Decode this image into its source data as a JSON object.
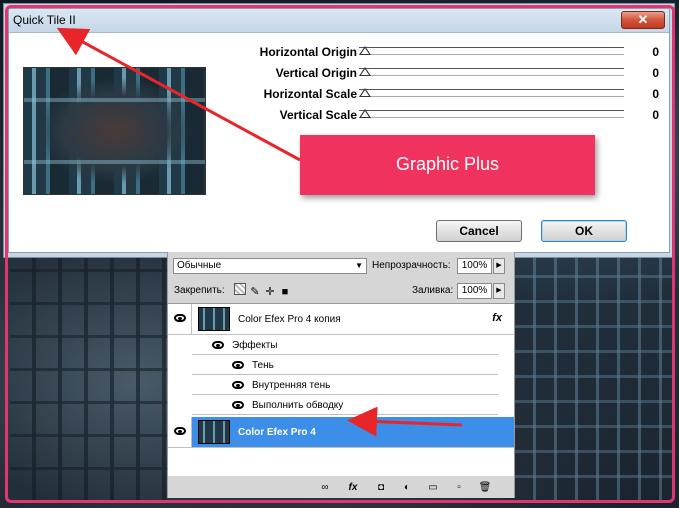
{
  "dialog": {
    "title": "Quick Tile II",
    "close_glyph": "✕",
    "params": [
      {
        "label": "Horizontal Origin",
        "value": "0"
      },
      {
        "label": "Vertical Origin",
        "value": "0"
      },
      {
        "label": "Horizontal Scale",
        "value": "0"
      },
      {
        "label": "Vertical Scale",
        "value": "0"
      }
    ],
    "cancel_label": "Cancel",
    "ok_label": "OK"
  },
  "callout": {
    "text": "Graphic Plus",
    "color": "#f0325f"
  },
  "layers_panel": {
    "blend_mode": "Обычные",
    "opacity_label": "Непрозрачность:",
    "opacity_value": "100%",
    "lock_label": "Закрепить:",
    "fill_label": "Заливка:",
    "fill_value": "100%",
    "layers": [
      {
        "name": "Color Efex Pro 4 копия",
        "fx": "fx",
        "selected": false
      },
      {
        "name": "Color Efex Pro 4",
        "selected": true
      }
    ],
    "effects_label": "Эффекты",
    "effects": [
      "Тень",
      "Внутренняя тень",
      "Выполнить обводку"
    ]
  },
  "colors": {
    "accent": "#e0356e",
    "selection": "#3d8ee8",
    "arrow": "#e8262a"
  }
}
